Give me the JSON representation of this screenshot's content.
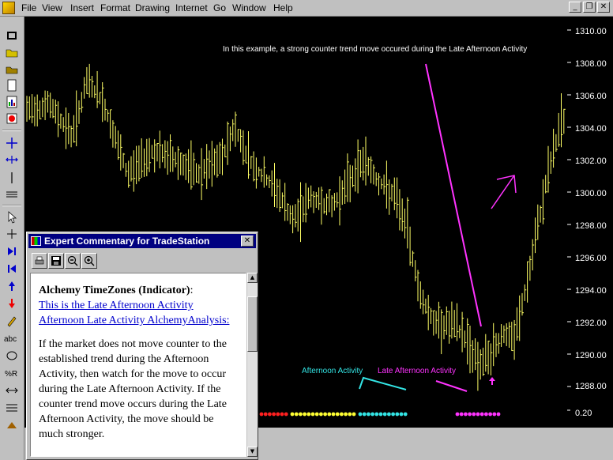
{
  "menu": {
    "items": [
      "File",
      "View",
      "Insert",
      "Format",
      "Drawing",
      "Internet",
      "Go",
      "Window",
      "Help"
    ],
    "window_buttons": [
      "_",
      "❐",
      "✕"
    ]
  },
  "toolbar": {
    "icons": [
      "open-workspace",
      "open-folder",
      "save",
      "new-document",
      "new-chart",
      "record",
      "cross-icon",
      "arrows-icon",
      "vertical-line",
      "horizontal-lines",
      "pointer",
      "crosshair",
      "next-bar",
      "first-bar",
      "up-arrow",
      "down-arrow",
      "pencil",
      "abc-text",
      "ellipse",
      "percent-retracement",
      "double-arrow",
      "lines",
      "hat"
    ]
  },
  "chart": {
    "annotation": "In this example, a strong counter trend move occured during the Late Afternoon Activity",
    "y_axis_labels": [
      "1310.00",
      "1308.00",
      "1306.00",
      "1304.00",
      "1302.00",
      "1300.00",
      "1298.00",
      "1296.00",
      "1294.00",
      "1292.00",
      "1290.00",
      "1288.00"
    ],
    "indicator_label": "0.20",
    "label_afternoon": "Afternoon Activity",
    "label_late_afternoon": "Late Afternoon Activity",
    "colors": {
      "bars": "#ffff66",
      "afternoon": "#33e5e5",
      "late_afternoon": "#ff33ff",
      "dots_red": "#ff2020",
      "dots_yellow": "#ffff33"
    }
  },
  "dialog": {
    "title": "Expert Commentary for TradeStation",
    "close": "✕",
    "tools": [
      "print",
      "save",
      "zoom-out",
      "zoom-in"
    ],
    "heading": "Alchemy TimeZones (Indicator)",
    "heading_suffix": ":",
    "link1": "This is the Late Afternoon Activity",
    "link2": "Afternoon Late Activity AlchemyAnalysis:",
    "body": "If the market does not move counter to the established trend during the Afternoon Activity, then watch for the move to occur during the Late Afternoon Activity. If the counter trend move occurs during the Late Afternoon Activity, the move should be much stronger."
  }
}
